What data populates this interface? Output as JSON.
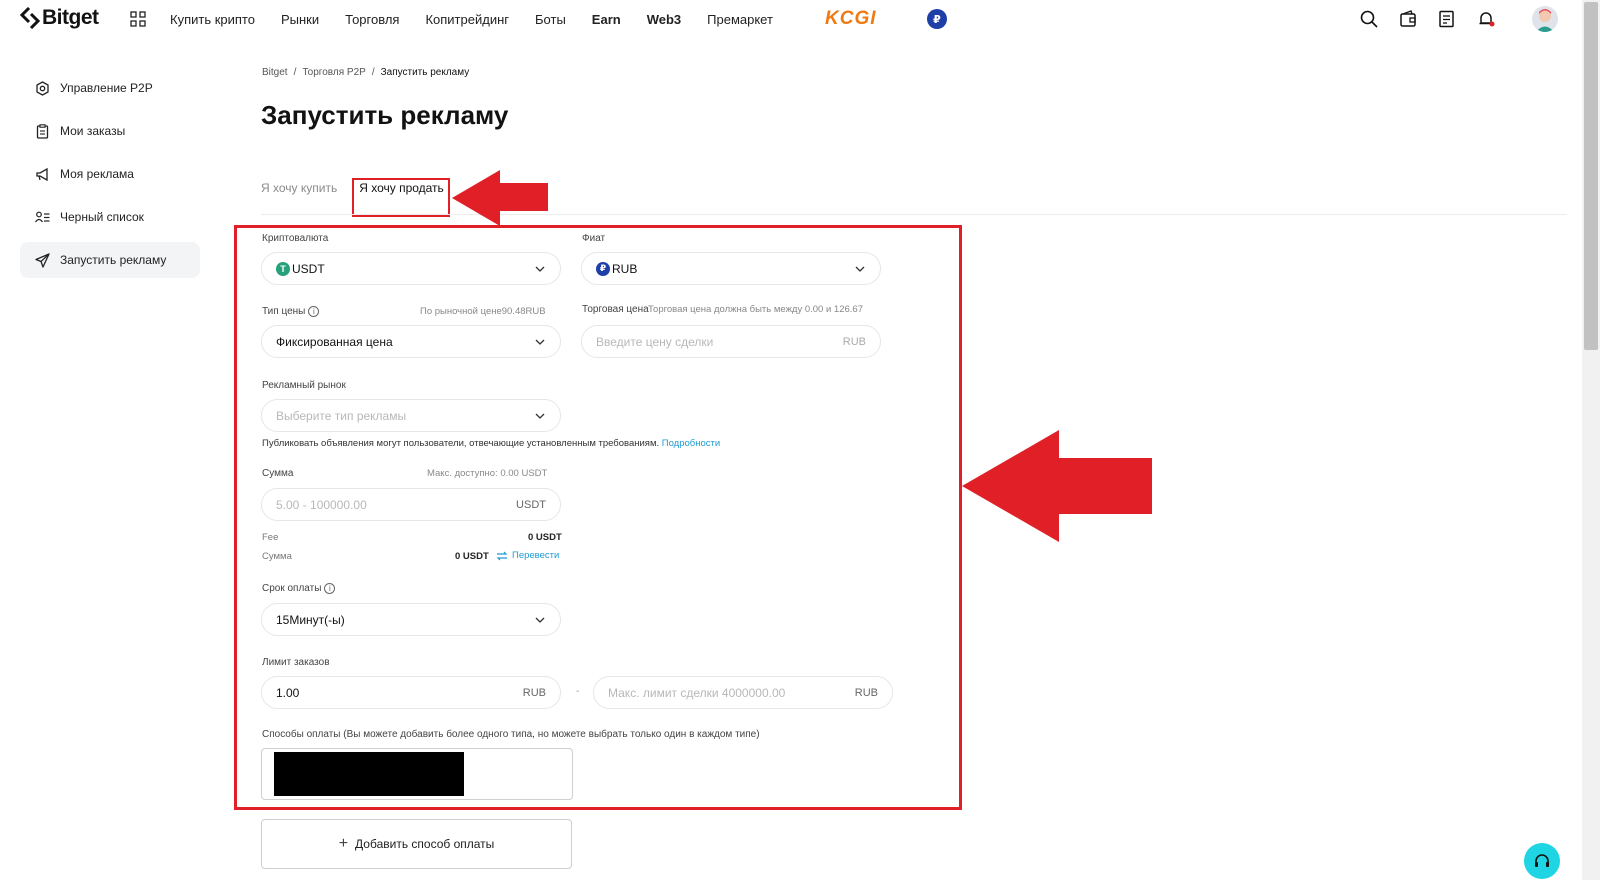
{
  "brand": {
    "name": "Bitget"
  },
  "nav": {
    "items": [
      "Купить крипто",
      "Рынки",
      "Торговля",
      "Копитрейдинг",
      "Боты",
      "Earn",
      "Web3",
      "Премаркет"
    ],
    "promo": "KCGI",
    "currency_badge": "₽"
  },
  "sidebar": {
    "items": [
      {
        "label": "Управление P2P",
        "icon": "settings-icon"
      },
      {
        "label": "Мои заказы",
        "icon": "clipboard-icon"
      },
      {
        "label": "Моя реклама",
        "icon": "megaphone-icon"
      },
      {
        "label": "Черный список",
        "icon": "user-list-icon"
      },
      {
        "label": "Запустить рекламу",
        "icon": "send-icon"
      }
    ],
    "active_index": 4
  },
  "breadcrumb": [
    "Bitget",
    "/",
    "Торговля P2P",
    "/",
    "Запустить рекламу"
  ],
  "page_title": "Запустить рекламу",
  "tabs": {
    "buy": "Я хочу купить",
    "sell": "Я хочу продать",
    "active": "sell"
  },
  "form": {
    "crypto": {
      "label": "Криптовалюта",
      "value": "USDT",
      "coin_glyph": "T"
    },
    "fiat": {
      "label": "Фиат",
      "value": "RUB",
      "coin_glyph": "₽"
    },
    "price_type": {
      "label": "Тип цены",
      "hint": "По рыночной цене90.48RUB",
      "value": "Фиксированная цена"
    },
    "trade_price": {
      "label": "Торговая цена",
      "hint": "Торговая цена должна быть между 0.00 и 126.67",
      "placeholder": "Введите цену сделки",
      "unit": "RUB"
    },
    "ad_market": {
      "label": "Рекламный рынок",
      "placeholder": "Выберите тип рекламы",
      "note": "Публиковать объявления могут пользователи, отвечающие установленным требованиям.",
      "link": "Подробности"
    },
    "amount": {
      "label": "Сумма",
      "hint": "Макс. доступно: 0.00 USDT",
      "placeholder": "5.00 - 100000.00",
      "unit": "USDT"
    },
    "fee": {
      "label": "Fee",
      "value": "0 USDT"
    },
    "total": {
      "label": "Сумма",
      "value": "0 USDT",
      "action": "Перевести"
    },
    "payment_term": {
      "label": "Срок оплаты",
      "value": "15Минут(-ы)"
    },
    "order_limit": {
      "label": "Лимит заказов",
      "min_value": "1.00",
      "min_unit": "RUB",
      "separator": "-",
      "max_placeholder": "Макс. лимит сделки 4000000.00",
      "max_unit": "RUB"
    },
    "payment_methods": {
      "label": "Способы оплаты (Вы можете добавить более одного типа, но можете выбрать только один в каждом типе)"
    },
    "add_payment": "Добавить способ оплаты"
  },
  "colors": {
    "annotation": "#e01f26",
    "link": "#1d9bd1",
    "promo": "#f07a12",
    "support": "#1fd5e3"
  }
}
